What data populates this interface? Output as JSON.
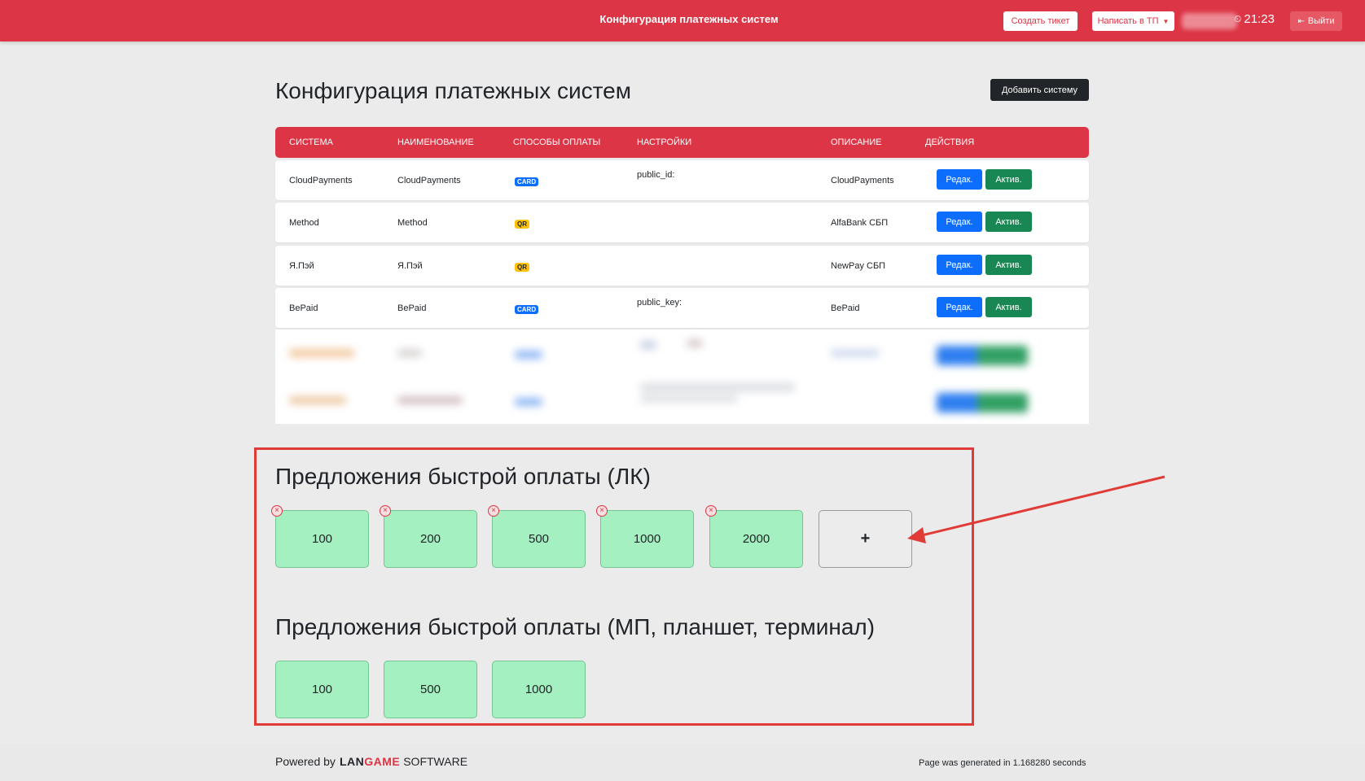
{
  "navbar": {
    "title": "Конфигурация платежных систем",
    "create_ticket": "Создать тикет",
    "write_support": "Написать в ТП",
    "time": "21:23",
    "logout": "Выйти"
  },
  "page": {
    "title": "Конфигурация платежных систем",
    "add_system": "Добавить систему"
  },
  "table": {
    "headers": [
      "Система",
      "Наименование",
      "Способы оплаты",
      "Настройки",
      "Описание",
      "Действия"
    ],
    "rows": [
      {
        "system": "CloudPayments",
        "name": "CloudPayments",
        "method": "CARD",
        "settings": "public_id:",
        "description": "CloudPayments",
        "edit": "Редак.",
        "activate": "Актив."
      },
      {
        "system": "Method",
        "name": "Method",
        "method": "QR",
        "settings": "",
        "description": "AlfaBank СБП",
        "edit": "Редак.",
        "activate": "Актив."
      },
      {
        "system": "Я.Пэй",
        "name": "Я.Пэй",
        "method": "QR",
        "settings": "",
        "description": "NewPay СБП",
        "edit": "Редак.",
        "activate": "Актив."
      },
      {
        "system": "BePaid",
        "name": "BePaid",
        "method": "CARD",
        "settings": "public_key:",
        "description": "BePaid",
        "edit": "Редак.",
        "activate": "Актив."
      }
    ]
  },
  "quick_lk": {
    "title": "Предложения быстрой оплаты (ЛК)",
    "amounts": [
      "100",
      "200",
      "500",
      "1000",
      "2000"
    ],
    "add_label": "+"
  },
  "quick_mp": {
    "title": "Предложения быстрой оплаты (МП, планшет, терминал)",
    "amounts": [
      "100",
      "500",
      "1000"
    ]
  },
  "footer": {
    "powered_by": "Powered by",
    "brand_lan": "LAN",
    "brand_game": "GAME",
    "brand_software": "SOFTWARE",
    "generated": "Page was generated in 1.168280 seconds"
  },
  "colors": {
    "primary_red": "#dc3545",
    "edit_blue": "#0d6efd",
    "activate_green": "#198754",
    "amount_green": "#a5f0c0",
    "highlight_red": "#e03b36"
  },
  "icons": {
    "clock": "clock-icon",
    "logout": "logout-icon",
    "remove": "remove-circle-icon",
    "caret": "caret-down-icon"
  }
}
